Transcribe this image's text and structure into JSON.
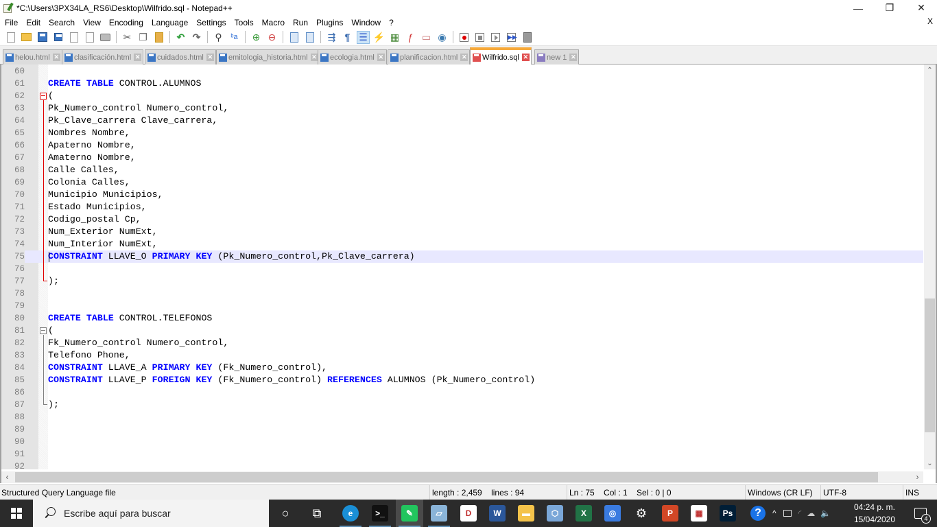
{
  "window": {
    "title": "*C:\\Users\\3PX34LA_RS6\\Desktop\\Wilfrido.sql - Notepad++",
    "controls": {
      "minimize": "—",
      "restore": "❐",
      "close": "✕"
    }
  },
  "menu": {
    "items": [
      "File",
      "Edit",
      "Search",
      "View",
      "Encoding",
      "Language",
      "Settings",
      "Tools",
      "Macro",
      "Run",
      "Plugins",
      "Window",
      "?"
    ],
    "close_doc": "X"
  },
  "toolbar": {
    "groups": [
      [
        "new-file-icon",
        "open-file-icon",
        "save-icon",
        "save-all-icon",
        "close-icon",
        "close-all-icon",
        "print-icon"
      ],
      [
        "cut-icon",
        "copy-icon",
        "paste-icon"
      ],
      [
        "undo-icon",
        "redo-icon"
      ],
      [
        "find-icon",
        "replace-icon"
      ],
      [
        "zoom-in-icon",
        "zoom-out-icon"
      ],
      [
        "sync-vertical-icon",
        "sync-horizontal-icon"
      ],
      [
        "word-wrap-icon",
        "show-all-chars-icon",
        "indent-guide-icon",
        "user-defined-language-icon",
        "document-map-icon",
        "function-list-icon",
        "folder-as-workspace-icon",
        "monitoring-icon"
      ],
      [
        "macro-record-icon",
        "macro-stop-icon",
        "macro-play-icon",
        "macro-run-multiple-icon",
        "macro-save-icon"
      ]
    ],
    "glyphs": {
      "cut": "✂",
      "copy": "❐",
      "paste": "📋",
      "undo": "↶",
      "redo": "↷",
      "find": "⚲",
      "replace": "ᵇa",
      "zoom_in": "⊕",
      "zoom_out": "⊖",
      "word_wrap": "⇶",
      "show_all": "¶",
      "indent_guide": "☰",
      "udl": "⚡",
      "map": "▦",
      "function_list": "ƒ",
      "folder": "▭",
      "monitor": "◉"
    }
  },
  "tabs": [
    {
      "label": "helou.html",
      "active": false
    },
    {
      "label": "clasificación.html",
      "active": false
    },
    {
      "label": "cuidados.html",
      "active": false
    },
    {
      "label": "emitologia_historia.html",
      "active": false
    },
    {
      "label": "ecologia.html",
      "active": false
    },
    {
      "label": "planificacion.html",
      "active": false
    },
    {
      "label": "Wilfrido.sql",
      "active": true
    },
    {
      "label": "new 1",
      "active": false
    }
  ],
  "tab_close_glyph": "✕",
  "editor": {
    "current_line": 75,
    "lines": [
      {
        "n": "60",
        "code": ""
      },
      {
        "n": "61",
        "code": "CREATE TABLE CONTROL.ALUMNOS"
      },
      {
        "n": "62",
        "code": "("
      },
      {
        "n": "63",
        "code": "Pk_Numero_control Numero_control,"
      },
      {
        "n": "64",
        "code": "Pk_Clave_carrera Clave_carrera,"
      },
      {
        "n": "65",
        "code": "Nombres Nombre,"
      },
      {
        "n": "66",
        "code": "Apaterno Nombre,"
      },
      {
        "n": "67",
        "code": "Amaterno Nombre,"
      },
      {
        "n": "68",
        "code": "Calle Calles,"
      },
      {
        "n": "69",
        "code": "Colonia Calles,"
      },
      {
        "n": "70",
        "code": "Municipio Municipios,"
      },
      {
        "n": "71",
        "code": "Estado Municipios,"
      },
      {
        "n": "72",
        "code": "Codigo_postal Cp,"
      },
      {
        "n": "73",
        "code": "Num_Exterior NumExt,"
      },
      {
        "n": "74",
        "code": "Num_Interior NumExt,"
      },
      {
        "n": "75",
        "code": "CONSTRAINT LLAVE_O PRIMARY KEY (Pk_Numero_control,Pk_Clave_carrera)"
      },
      {
        "n": "76",
        "code": ""
      },
      {
        "n": "77",
        "code": ");"
      },
      {
        "n": "78",
        "code": ""
      },
      {
        "n": "79",
        "code": ""
      },
      {
        "n": "80",
        "code": "CREATE TABLE CONTROL.TELEFONOS"
      },
      {
        "n": "81",
        "code": "("
      },
      {
        "n": "82",
        "code": "Fk_Numero_control Numero_control,"
      },
      {
        "n": "83",
        "code": "Telefono Phone,"
      },
      {
        "n": "84",
        "code": "CONSTRAINT LLAVE_A PRIMARY KEY (Fk_Numero_control),"
      },
      {
        "n": "85",
        "code": "CONSTRAINT LLAVE_P FOREIGN KEY (Fk_Numero_control) REFERENCES ALUMNOS (Pk_Numero_control)"
      },
      {
        "n": "86",
        "code": ""
      },
      {
        "n": "87",
        "code": ");"
      },
      {
        "n": "88",
        "code": ""
      },
      {
        "n": "89",
        "code": ""
      },
      {
        "n": "90",
        "code": ""
      },
      {
        "n": "91",
        "code": ""
      },
      {
        "n": "92",
        "code": ""
      }
    ],
    "keywords": [
      "CREATE",
      "TABLE",
      "CONSTRAINT",
      "PRIMARY",
      "KEY",
      "FOREIGN",
      "REFERENCES"
    ],
    "scroll": {
      "vertical_position_fraction": 0.74,
      "vertical_visible_fraction": 0.35,
      "up": "⌃",
      "down": "⌄",
      "left": "‹",
      "right": "›"
    }
  },
  "statusbar": {
    "file_type": "Structured Query Language file",
    "length_lines": "length : 2,459    lines : 94",
    "position": "Ln : 75    Col : 1    Sel : 0 | 0",
    "eol": "Windows (CR LF)",
    "encoding": "UTF-8",
    "mode": "INS"
  },
  "taskbar": {
    "search_placeholder": "Escribe aquí para buscar",
    "apps": [
      {
        "name": "cortana",
        "glyph": "○",
        "color": "transparent"
      },
      {
        "name": "task-view",
        "glyph": "⧉",
        "color": "transparent"
      },
      {
        "name": "edge",
        "glyph": "e",
        "color": "#1a8fd6"
      },
      {
        "name": "command-prompt",
        "glyph": ">_",
        "color": "#111111"
      },
      {
        "name": "notepad-plus-plus",
        "glyph": "✎",
        "color": "#22c55e"
      },
      {
        "name": "notepad",
        "glyph": "▱",
        "color": "#8ab4d8"
      },
      {
        "name": "dia-diagram",
        "glyph": "D",
        "color": "#ffffff"
      },
      {
        "name": "word",
        "glyph": "W",
        "color": "#2b579a"
      },
      {
        "name": "file-explorer",
        "glyph": "▬",
        "color": "#f4c34a"
      },
      {
        "name": "virtualbox",
        "glyph": "⬡",
        "color": "#7aa7d8"
      },
      {
        "name": "excel",
        "glyph": "X",
        "color": "#217346"
      },
      {
        "name": "network-app",
        "glyph": "◎",
        "color": "#3a7be0"
      },
      {
        "name": "settings-gear",
        "glyph": "⚙",
        "color": "transparent"
      },
      {
        "name": "powerpoint",
        "glyph": "P",
        "color": "#d24726"
      },
      {
        "name": "microsoft-store",
        "glyph": "▦",
        "color": "#ffffff"
      },
      {
        "name": "photoshop",
        "glyph": "Ps",
        "color": "#001e36"
      }
    ],
    "tray": {
      "help": "?",
      "chevron": "^",
      "time": "04:24 p. m.",
      "date": "15/04/2020",
      "notifications": "4"
    }
  }
}
